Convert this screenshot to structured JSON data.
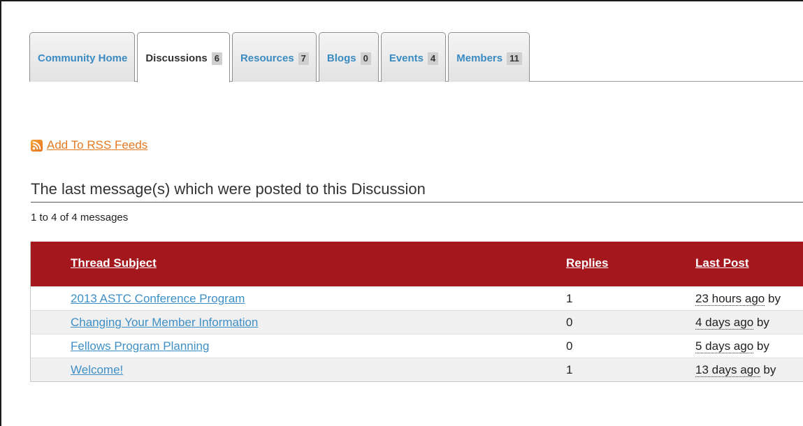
{
  "tabs": [
    {
      "label": "Community Home",
      "count": "",
      "active": false
    },
    {
      "label": "Discussions",
      "count": "6",
      "active": true
    },
    {
      "label": "Resources",
      "count": "7",
      "active": false
    },
    {
      "label": "Blogs",
      "count": "0",
      "active": false
    },
    {
      "label": "Events",
      "count": "4",
      "active": false
    },
    {
      "label": "Members",
      "count": "11",
      "active": false
    }
  ],
  "rss": {
    "icon": "rss-icon",
    "link_label": "Add To RSS Feeds"
  },
  "section": {
    "heading": "The last message(s) which were posted to this Discussion",
    "message_count": "1 to 4 of 4 messages"
  },
  "table": {
    "headers": {
      "subject": "Thread Subject",
      "replies": "Replies",
      "last_post": "Last Post"
    },
    "rows": [
      {
        "subject": "2013 ASTC Conference Program",
        "replies": "1",
        "last_post_time": "23 hours ago",
        "last_post_by": "by"
      },
      {
        "subject": "Changing Your Member Information",
        "replies": "0",
        "last_post_time": "4 days ago",
        "last_post_by": "by"
      },
      {
        "subject": "Fellows Program Planning",
        "replies": "0",
        "last_post_time": "5 days ago",
        "last_post_by": "by"
      },
      {
        "subject": "Welcome!",
        "replies": "1",
        "last_post_time": "13 days ago",
        "last_post_by": "by"
      }
    ]
  },
  "colors": {
    "header_bg": "#a4171d",
    "link_blue": "#3e8fc6",
    "rss_orange": "#e57a22",
    "row_alt": "#f0f0f0"
  }
}
